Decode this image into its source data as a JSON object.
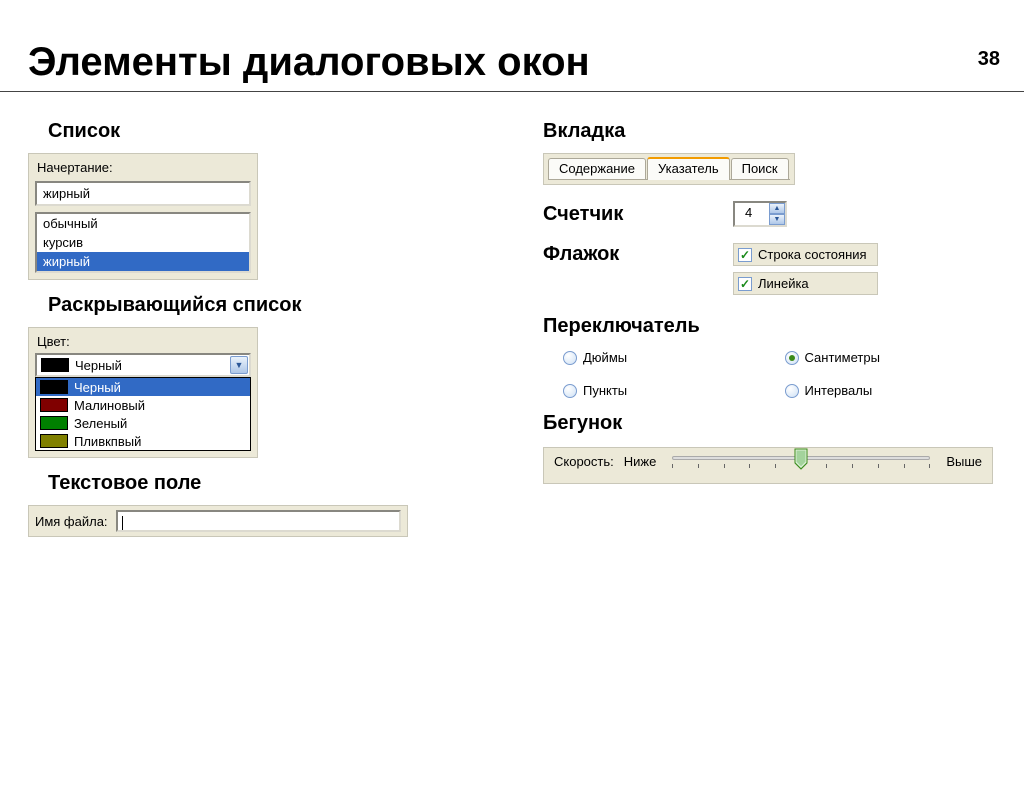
{
  "page_number": "38",
  "title": "Элементы диалоговых окон",
  "left": {
    "list": {
      "title": "Список",
      "label": "Начертание:",
      "value": "жирный",
      "items": [
        "обычный",
        "курсив",
        "жирный"
      ],
      "selected_index": 2
    },
    "dropdown": {
      "title": "Раскрывающийся список",
      "label": "Цвет:",
      "value_text": "Черный",
      "items": [
        {
          "color": "#000000",
          "label": "Черный"
        },
        {
          "color": "#800000",
          "label": "Малиновый"
        },
        {
          "color": "#008000",
          "label": "Зеленый"
        },
        {
          "color": "#808000",
          "label": "Пливкпвый"
        }
      ],
      "selected_index": 0
    },
    "textfield": {
      "title": "Текстовое поле",
      "label": "Имя файла:"
    }
  },
  "right": {
    "tabs": {
      "title": "Вкладка",
      "items": [
        "Содержание",
        "Указатель",
        "Поиск"
      ],
      "active_index": 1
    },
    "spinner": {
      "title": "Счетчик",
      "value": "4"
    },
    "checkbox": {
      "title": "Флажок",
      "items": [
        "Строка состояния",
        "Линейка"
      ]
    },
    "radio": {
      "title": "Переключатель",
      "items": [
        "Дюймы",
        "Сантиметры",
        "Пункты",
        "Интервалы"
      ],
      "selected_index": 1
    },
    "slider": {
      "title": "Бегунок",
      "label": "Скорость:",
      "low": "Ниже",
      "high": "Выше"
    }
  }
}
